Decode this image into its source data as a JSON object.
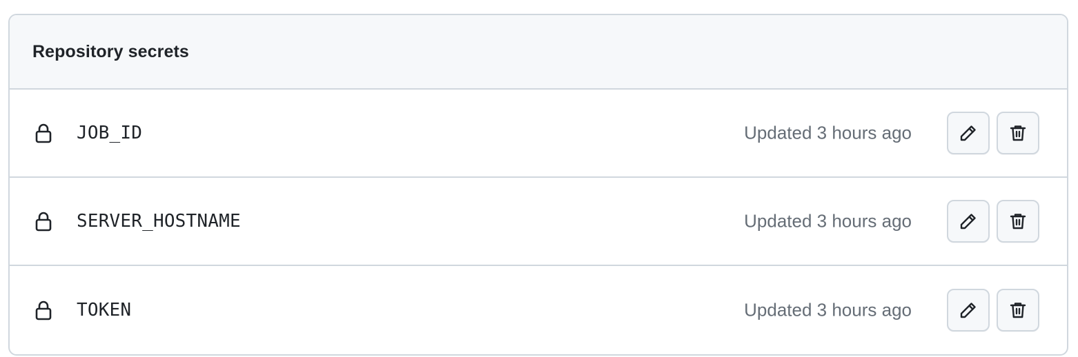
{
  "panel": {
    "title": "Repository secrets"
  },
  "secrets": [
    {
      "name": "JOB_ID",
      "updated": "Updated 3 hours ago",
      "icon": "lock-icon"
    },
    {
      "name": "SERVER_HOSTNAME",
      "updated": "Updated 3 hours ago",
      "icon": "lock-icon"
    },
    {
      "name": "TOKEN",
      "updated": "Updated 3 hours ago",
      "icon": "lock-icon"
    }
  ],
  "actions": {
    "edit_icon": "pencil-icon",
    "delete_icon": "trash-icon"
  },
  "colors": {
    "border": "#d0d7de",
    "header_bg": "#f6f8fa",
    "text": "#1f2328",
    "muted_text": "#656d76"
  }
}
